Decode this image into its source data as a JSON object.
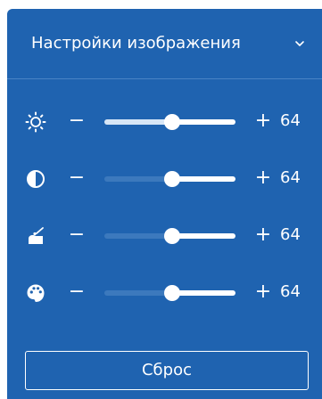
{
  "panel": {
    "title": "Настройки изображения",
    "chevron_icon": "chevron-down-icon",
    "background_color": "#1f63b0",
    "text_color": "#ffffff"
  },
  "controls": [
    {
      "id": "brightness",
      "icon": "brightness-icon",
      "minus_label": "−",
      "plus_label": "+",
      "value": "64",
      "level_percent": 52
    },
    {
      "id": "contrast",
      "icon": "contrast-icon",
      "minus_label": "−",
      "plus_label": "+",
      "value": "64",
      "level_percent": 52
    },
    {
      "id": "sharpness",
      "icon": "sharpness-icon",
      "minus_label": "−",
      "plus_label": "+",
      "value": "64",
      "level_percent": 52
    },
    {
      "id": "color",
      "icon": "color-palette-icon",
      "minus_label": "−",
      "plus_label": "+",
      "value": "64",
      "level_percent": 52
    }
  ],
  "reset_button": {
    "label": "Сброс"
  }
}
